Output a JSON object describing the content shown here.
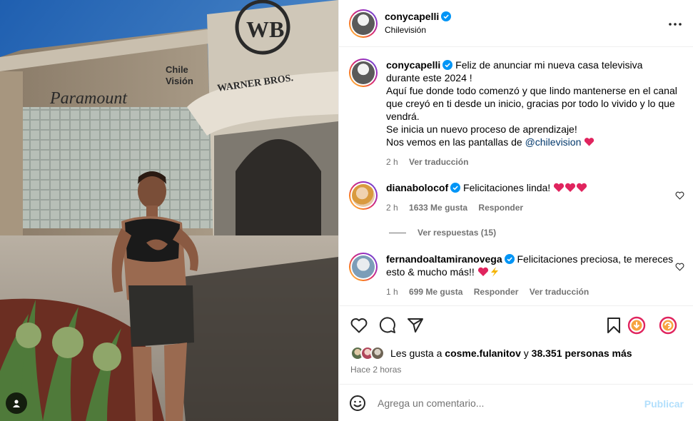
{
  "post": {
    "author": "conycapelli",
    "location": "Chilevisión"
  },
  "caption": {
    "author": "conycapelli",
    "lines": [
      "Feliz de anunciar mi nueva casa televisiva durante este 2024 !",
      "Aquí fue donde todo comenzó y que lindo mantenerse en el canal que creyó en ti desde un inicio, gracias por todo lo vivido y lo que vendrá.",
      "Se inicia un nuevo proceso de aprendizaje!"
    ],
    "last_line_prefix": "Nos vemos en las pantallas de",
    "mention": "@chilevision",
    "time": "2 h",
    "translate": "Ver traducción"
  },
  "comments": [
    {
      "author": "dianabolocof",
      "text": "Felicitaciones linda!",
      "time": "2 h",
      "likes": "1633 Me gusta",
      "reply": "Responder"
    },
    {
      "author": "fernandoaltamiranovega",
      "text": "Felicitaciones preciosa, te mereces esto & mucho más!!",
      "time": "1 h",
      "likes": "699 Me gusta",
      "reply": "Responder",
      "translate": "Ver traducción"
    }
  ],
  "view_replies": "Ver respuestas (15)",
  "likes_summary": {
    "prefix": "Les gusta a",
    "user": "cosme.fulanitov",
    "conj": "y",
    "count": "38.351 personas más"
  },
  "posted_ago": "Hace 2 horas",
  "composer": {
    "placeholder": "Agrega un comentario...",
    "post_label": "Publicar"
  },
  "photo_signage": {
    "wb": "WB",
    "warner": "WARNER BROS.",
    "paramount": "Paramount",
    "chv_1": "Chile",
    "chv_2": "Visión"
  },
  "colors": {
    "verified": "#0095f6",
    "heart": "#e0245e",
    "link": "#00376b",
    "muted": "#737373"
  }
}
